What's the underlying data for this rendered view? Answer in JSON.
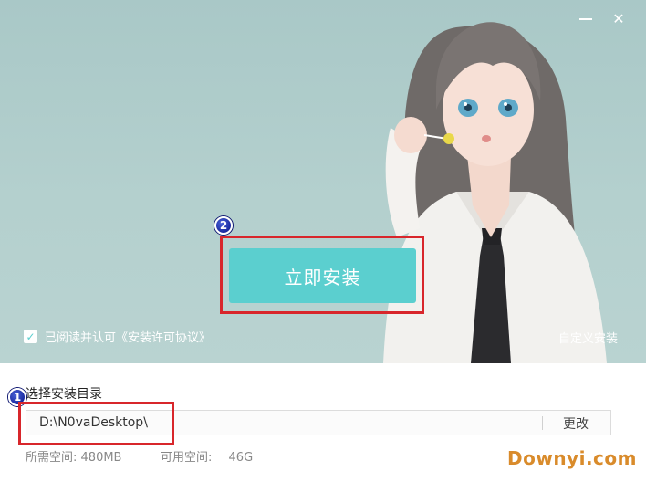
{
  "window": {
    "minimize_icon": "minimize-icon",
    "close_icon": "close-icon"
  },
  "hero": {
    "install_label": "立即安装",
    "agree_text": "已阅读并认可《安装许可协议》",
    "custom_install_label": "自定义安装"
  },
  "install": {
    "dir_label": "选择安装目录",
    "path_value": "D:\\N0vaDesktop\\",
    "change_label": "更改",
    "required_label": "所需空间:",
    "required_value": "480MB",
    "available_label": "可用空间:",
    "available_value": "46G"
  },
  "annotations": {
    "badge_1": "1",
    "badge_2": "2"
  },
  "watermark": "Downyi.com",
  "colors": {
    "accent": "#5bcfcf",
    "highlight_frame": "#d8262b",
    "hero_bg": "#b4d0ce"
  }
}
